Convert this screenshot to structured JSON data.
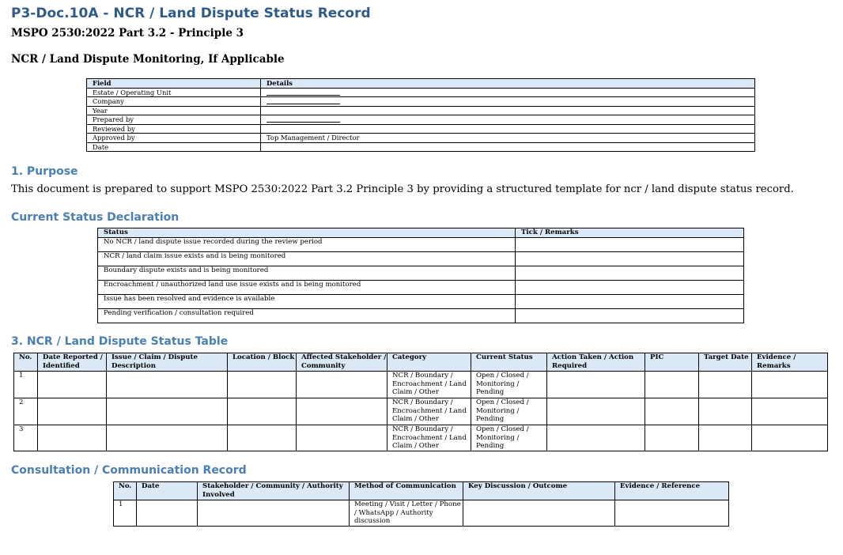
{
  "doc": {
    "title": "P3-Doc.10A - NCR / Land Dispute Status Record",
    "subtitle": "MSPO 2530:2022 Part 3.2 - Principle 3",
    "monitoring_heading": "NCR / Land Dispute Monitoring, If Applicable"
  },
  "info_table": {
    "headers": [
      "Field",
      "Details"
    ],
    "rows": [
      {
        "field": "Estate / Operating Unit",
        "details": ""
      },
      {
        "field": "Company",
        "details": ""
      },
      {
        "field": "Year",
        "details": ""
      },
      {
        "field": "Prepared by",
        "details": ""
      },
      {
        "field": "Reviewed by",
        "details": ""
      },
      {
        "field": "Approved by",
        "details": "Top Management / Director"
      },
      {
        "field": "Date",
        "details": ""
      }
    ]
  },
  "purpose": {
    "heading": "1. Purpose",
    "text": "This document is prepared to support MSPO 2530:2022 Part 3.2 Principle 3 by providing a structured template for ncr / land dispute status record."
  },
  "status_declaration": {
    "heading": "Current Status Declaration",
    "headers": [
      "Status",
      "Tick / Remarks"
    ],
    "rows": [
      {
        "status": "No NCR / land dispute issue recorded during the review period",
        "remarks": ""
      },
      {
        "status": "NCR / land claim issue exists and is being monitored",
        "remarks": ""
      },
      {
        "status": "Boundary dispute exists and is being monitored",
        "remarks": ""
      },
      {
        "status": "Encroachment / unauthorized land use issue exists and is being monitored",
        "remarks": ""
      },
      {
        "status": "Issue has been resolved and evidence is available",
        "remarks": ""
      },
      {
        "status": "Pending verification / consultation required",
        "remarks": ""
      }
    ]
  },
  "status_table": {
    "heading": "3. NCR / Land Dispute Status Table",
    "headers": [
      "No.",
      "Date Reported / Identified",
      "Issue / Claim / Dispute Description",
      "Location / Block",
      "Affected Stakeholder / Community",
      "Category",
      "Current Status",
      "Action Taken / Action Required",
      "PIC",
      "Target Date",
      "Evidence / Remarks"
    ],
    "rows": [
      {
        "no": "1",
        "category": "NCR / Boundary / Encroachment / Land Claim / Other",
        "status": "Open / Closed / Monitoring / Pending"
      },
      {
        "no": "2",
        "category": "NCR / Boundary / Encroachment / Land Claim / Other",
        "status": "Open / Closed / Monitoring / Pending"
      },
      {
        "no": "3",
        "category": "NCR / Boundary / Encroachment / Land Claim / Other",
        "status": "Open / Closed / Monitoring / Pending"
      }
    ]
  },
  "consultation": {
    "heading": "Consultation / Communication Record",
    "headers": [
      "No.",
      "Date",
      "Stakeholder / Community / Authority Involved",
      "Method of Communication",
      "Key Discussion / Outcome",
      "Evidence / Reference"
    ],
    "rows": [
      {
        "no": "1",
        "method": "Meeting / Visit / Letter / Phone / WhatsApp / Authority discussion"
      }
    ]
  }
}
